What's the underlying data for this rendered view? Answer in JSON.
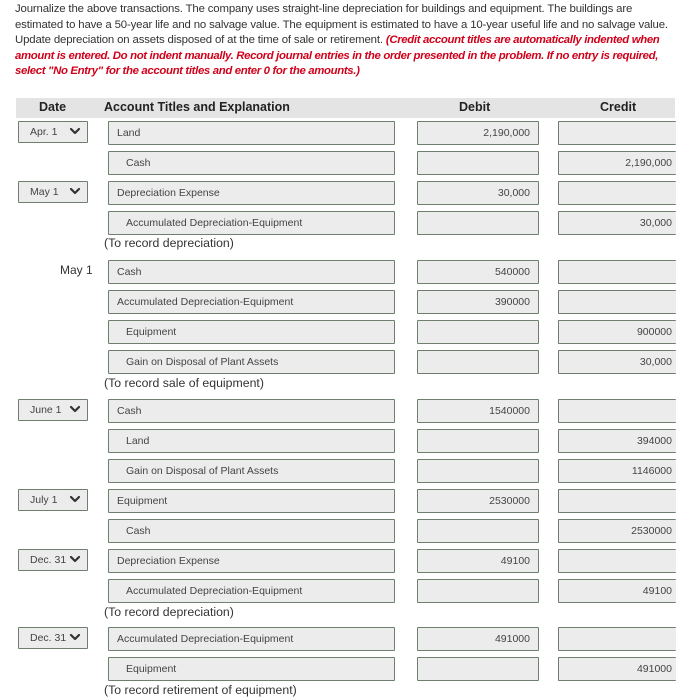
{
  "instructions": {
    "text": "Journalize the above transactions. The company uses straight-line depreciation for buildings and equipment. The buildings are estimated to have a 50-year life and no salvage value. The equipment is estimated to have a 10-year useful life and no salvage value. Update depreciation on assets disposed of at the time of sale or retirement. ",
    "note": "(Credit account titles are automatically indented when amount is entered. Do not indent manually. Record journal entries in the order presented in the problem. If no entry is required, select \"No Entry\" for the account titles and enter 0 for the amounts.)"
  },
  "header": {
    "date": "Date",
    "account": "Account Titles and Explanation",
    "debit": "Debit",
    "credit": "Credit"
  },
  "entries": [
    {
      "date": "Apr. 1",
      "date_type": "select",
      "lines": [
        {
          "account": "Land",
          "indent": false,
          "debit": "2,190,000",
          "credit": ""
        },
        {
          "account": "Cash",
          "indent": true,
          "debit": "",
          "credit": "2,190,000"
        }
      ],
      "explanation": ""
    },
    {
      "date": "May 1",
      "date_type": "select",
      "lines": [
        {
          "account": "Depreciation Expense",
          "indent": false,
          "debit": "30,000",
          "credit": ""
        },
        {
          "account": "Accumulated Depreciation-Equipment",
          "indent": true,
          "debit": "",
          "credit": "30,000"
        }
      ],
      "explanation": "(To record depreciation)"
    },
    {
      "date": "May 1",
      "date_type": "text",
      "lines": [
        {
          "account": "Cash",
          "indent": false,
          "debit": "540000",
          "credit": ""
        },
        {
          "account": "Accumulated Depreciation-Equipment",
          "indent": false,
          "debit": "390000",
          "credit": ""
        },
        {
          "account": "Equipment",
          "indent": true,
          "debit": "",
          "credit": "900000"
        },
        {
          "account": "Gain on Disposal of Plant Assets",
          "indent": true,
          "debit": "",
          "credit": "30,000"
        }
      ],
      "explanation": "(To record sale of equipment)"
    },
    {
      "date": "June 1",
      "date_type": "select",
      "lines": [
        {
          "account": "Cash",
          "indent": false,
          "debit": "1540000",
          "credit": ""
        },
        {
          "account": "Land",
          "indent": true,
          "debit": "",
          "credit": "394000"
        },
        {
          "account": "Gain on Disposal of Plant Assets",
          "indent": true,
          "debit": "",
          "credit": "1146000"
        }
      ],
      "explanation": ""
    },
    {
      "date": "July 1",
      "date_type": "select",
      "lines": [
        {
          "account": "Equipment",
          "indent": false,
          "debit": "2530000",
          "credit": ""
        },
        {
          "account": "Cash",
          "indent": true,
          "debit": "",
          "credit": "2530000"
        }
      ],
      "explanation": ""
    },
    {
      "date": "Dec. 31",
      "date_type": "select",
      "lines": [
        {
          "account": "Depreciation Expense",
          "indent": false,
          "debit": "49100",
          "credit": ""
        },
        {
          "account": "Accumulated Depreciation-Equipment",
          "indent": true,
          "debit": "",
          "credit": "49100"
        }
      ],
      "explanation": "(To record depreciation)"
    },
    {
      "date": "Dec. 31",
      "date_type": "select",
      "lines": [
        {
          "account": "Accumulated Depreciation-Equipment",
          "indent": false,
          "debit": "491000",
          "credit": ""
        },
        {
          "account": "Equipment",
          "indent": true,
          "debit": "",
          "credit": "491000"
        }
      ],
      "explanation": "(To record retirement of equipment)"
    }
  ]
}
